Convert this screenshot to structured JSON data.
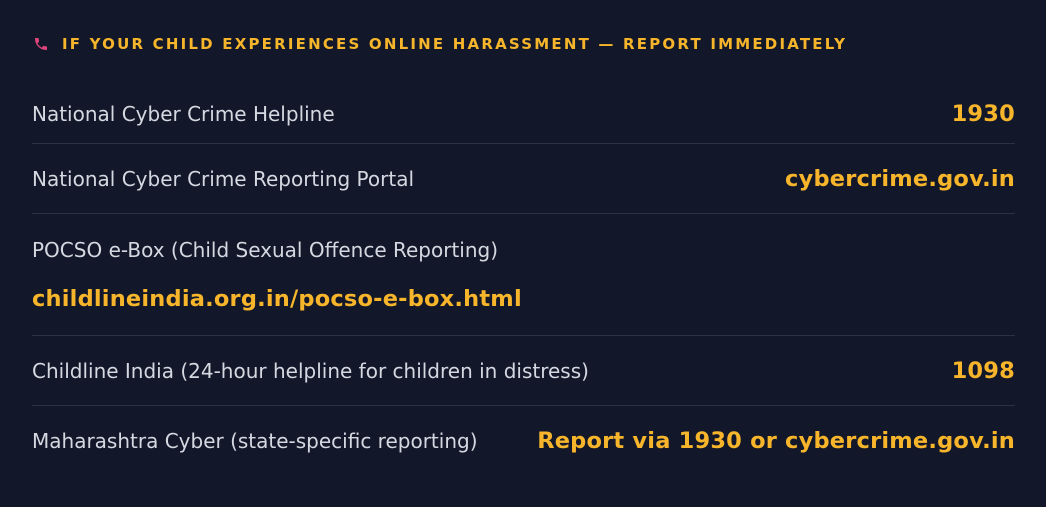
{
  "header": {
    "icon": "phone-icon",
    "title": "If your child experiences online harassment — report immediately"
  },
  "contacts": [
    {
      "label": "National Cyber Crime Helpline",
      "value": "1930"
    },
    {
      "label": "National Cyber Crime Reporting Portal",
      "value": "cybercrime.gov.in"
    },
    {
      "label": "POCSO e-Box (Child Sexual Offence Reporting)",
      "value": "childlineindia.org.in/pocso-e-box.html"
    },
    {
      "label": "Childline India (24-hour helpline for children in distress)",
      "value": "1098"
    },
    {
      "label": "Maharashtra Cyber (state-specific reporting)",
      "value": "Report via 1930 or cybercrime.gov.in"
    }
  ],
  "colors": {
    "background": "#121829",
    "accent": "#f7b52b",
    "icon": "#e0457b",
    "text": "#d4d8e1",
    "divider": "#2b3244"
  }
}
